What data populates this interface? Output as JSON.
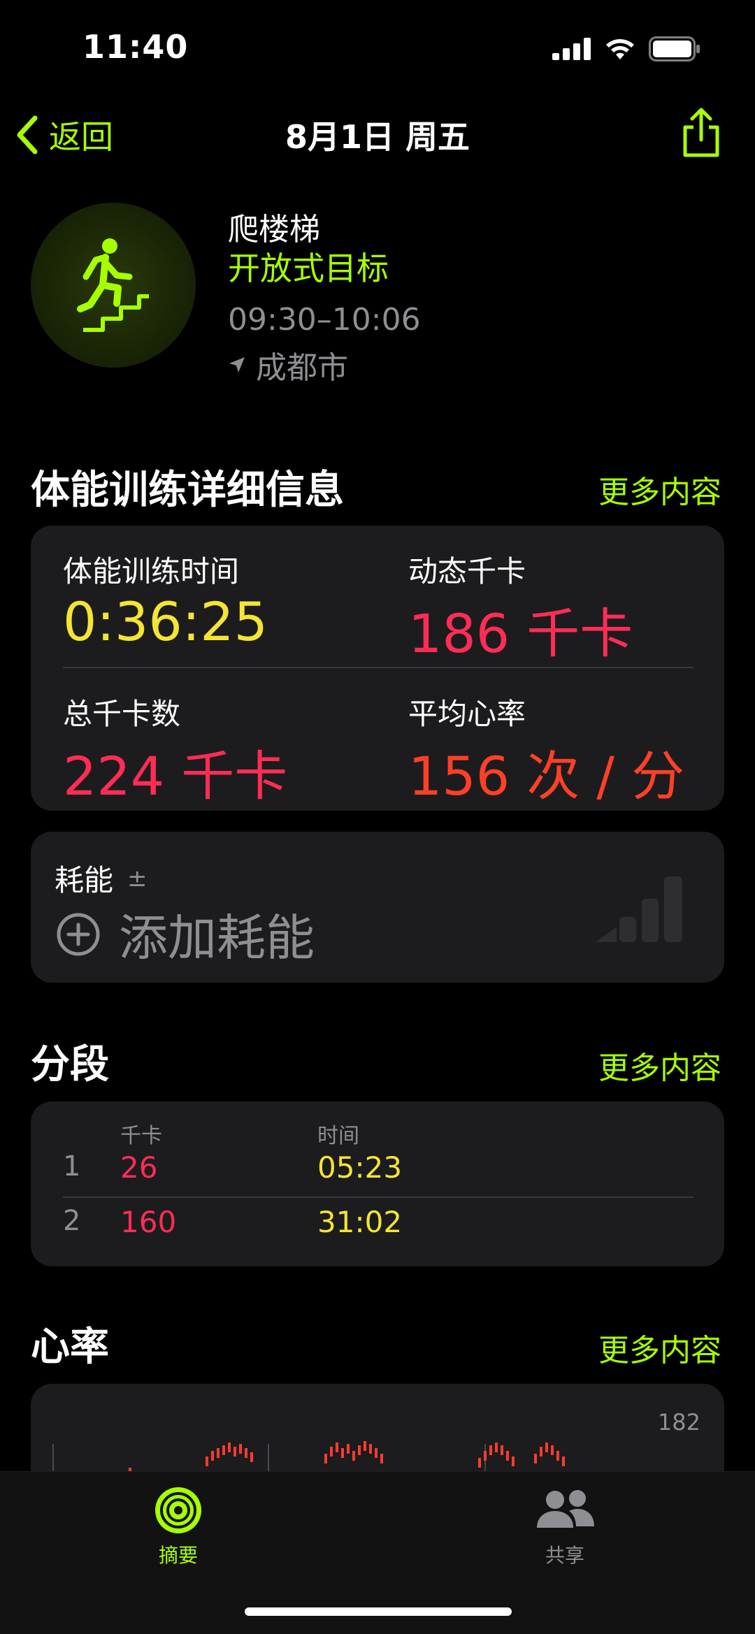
{
  "status_bar": {
    "time": "11:40"
  },
  "nav": {
    "back_label": "返回",
    "title": "8月1日 周五"
  },
  "workout": {
    "name": "爬楼梯",
    "goal": "开放式目标",
    "time_range": "09:30–10:06",
    "location": "成都市",
    "icon": "stair-climbing-icon"
  },
  "details": {
    "title": "体能训练详细信息",
    "more": "更多内容",
    "metrics": [
      {
        "label": "体能训练时间",
        "value": "0:36:25",
        "color": "#f5e533"
      },
      {
        "label": "动态千卡",
        "value": "186 千卡",
        "color": "#ff2d55"
      },
      {
        "label": "总千卡数",
        "value": "224 千卡",
        "color": "#ff2d55"
      },
      {
        "label": "平均心率",
        "value": "156 次 / 分",
        "color": "#ff4026"
      }
    ]
  },
  "effort": {
    "label": "耗能",
    "label_suffix": "±",
    "add_label": "添加耗能"
  },
  "splits": {
    "title": "分段",
    "more": "更多内容",
    "col_kcal": "千卡",
    "col_time": "时间",
    "rows": [
      {
        "num": "1",
        "kcal": "26",
        "time": "05:23"
      },
      {
        "num": "2",
        "kcal": "160",
        "time": "31:02"
      }
    ]
  },
  "heart_rate": {
    "title": "心率",
    "more": "更多内容",
    "max_label": "182"
  },
  "tabbar": {
    "summary_label": "摘要",
    "sharing_label": "共享"
  },
  "colors": {
    "accent": "#a6ff00",
    "calories": "#ff2d55",
    "duration": "#f5e533",
    "heart": "#ff4026"
  }
}
